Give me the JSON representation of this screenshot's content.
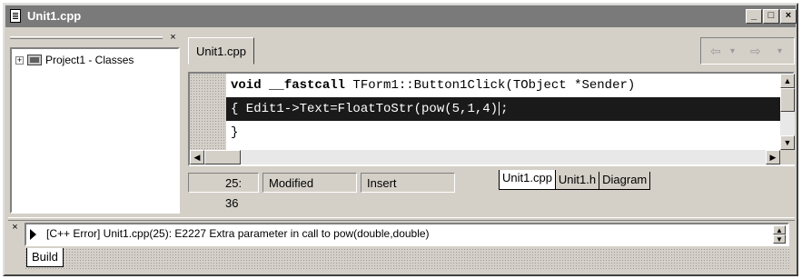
{
  "window": {
    "title": "Unit1.cpp",
    "minimize": "_",
    "maximize": "□",
    "close": "×"
  },
  "class_explorer": {
    "close": "×",
    "tree_items": [
      {
        "expander": "+",
        "label": "Project1 - Classes"
      }
    ]
  },
  "editor": {
    "file_tab": "Unit1.cpp",
    "nav": {
      "back": "⇦",
      "back_dropdown": "▾",
      "forward": "⇨",
      "forward_dropdown": "▾"
    },
    "code_lines": [
      {
        "keyword1": "void",
        "keyword2": "__fastcall",
        "rest": " TForm1::Button1Click(TObject *Sender)"
      },
      {
        "text_before_caret": "{ Edit1->Text=FloatToStr(pow(5,1,4)",
        "text_after_caret": ";",
        "selected": true
      },
      {
        "text": "}"
      }
    ]
  },
  "statusbar": {
    "position": "25: 36",
    "modified": "Modified",
    "mode": "Insert",
    "view_tabs": [
      "Unit1.cpp",
      "Unit1.h",
      "Diagram"
    ]
  },
  "messages": {
    "close": "×",
    "text": "[C++ Error] Unit1.cpp(25): E2227 Extra parameter in call to pow(double,double)",
    "tab": "Build"
  }
}
